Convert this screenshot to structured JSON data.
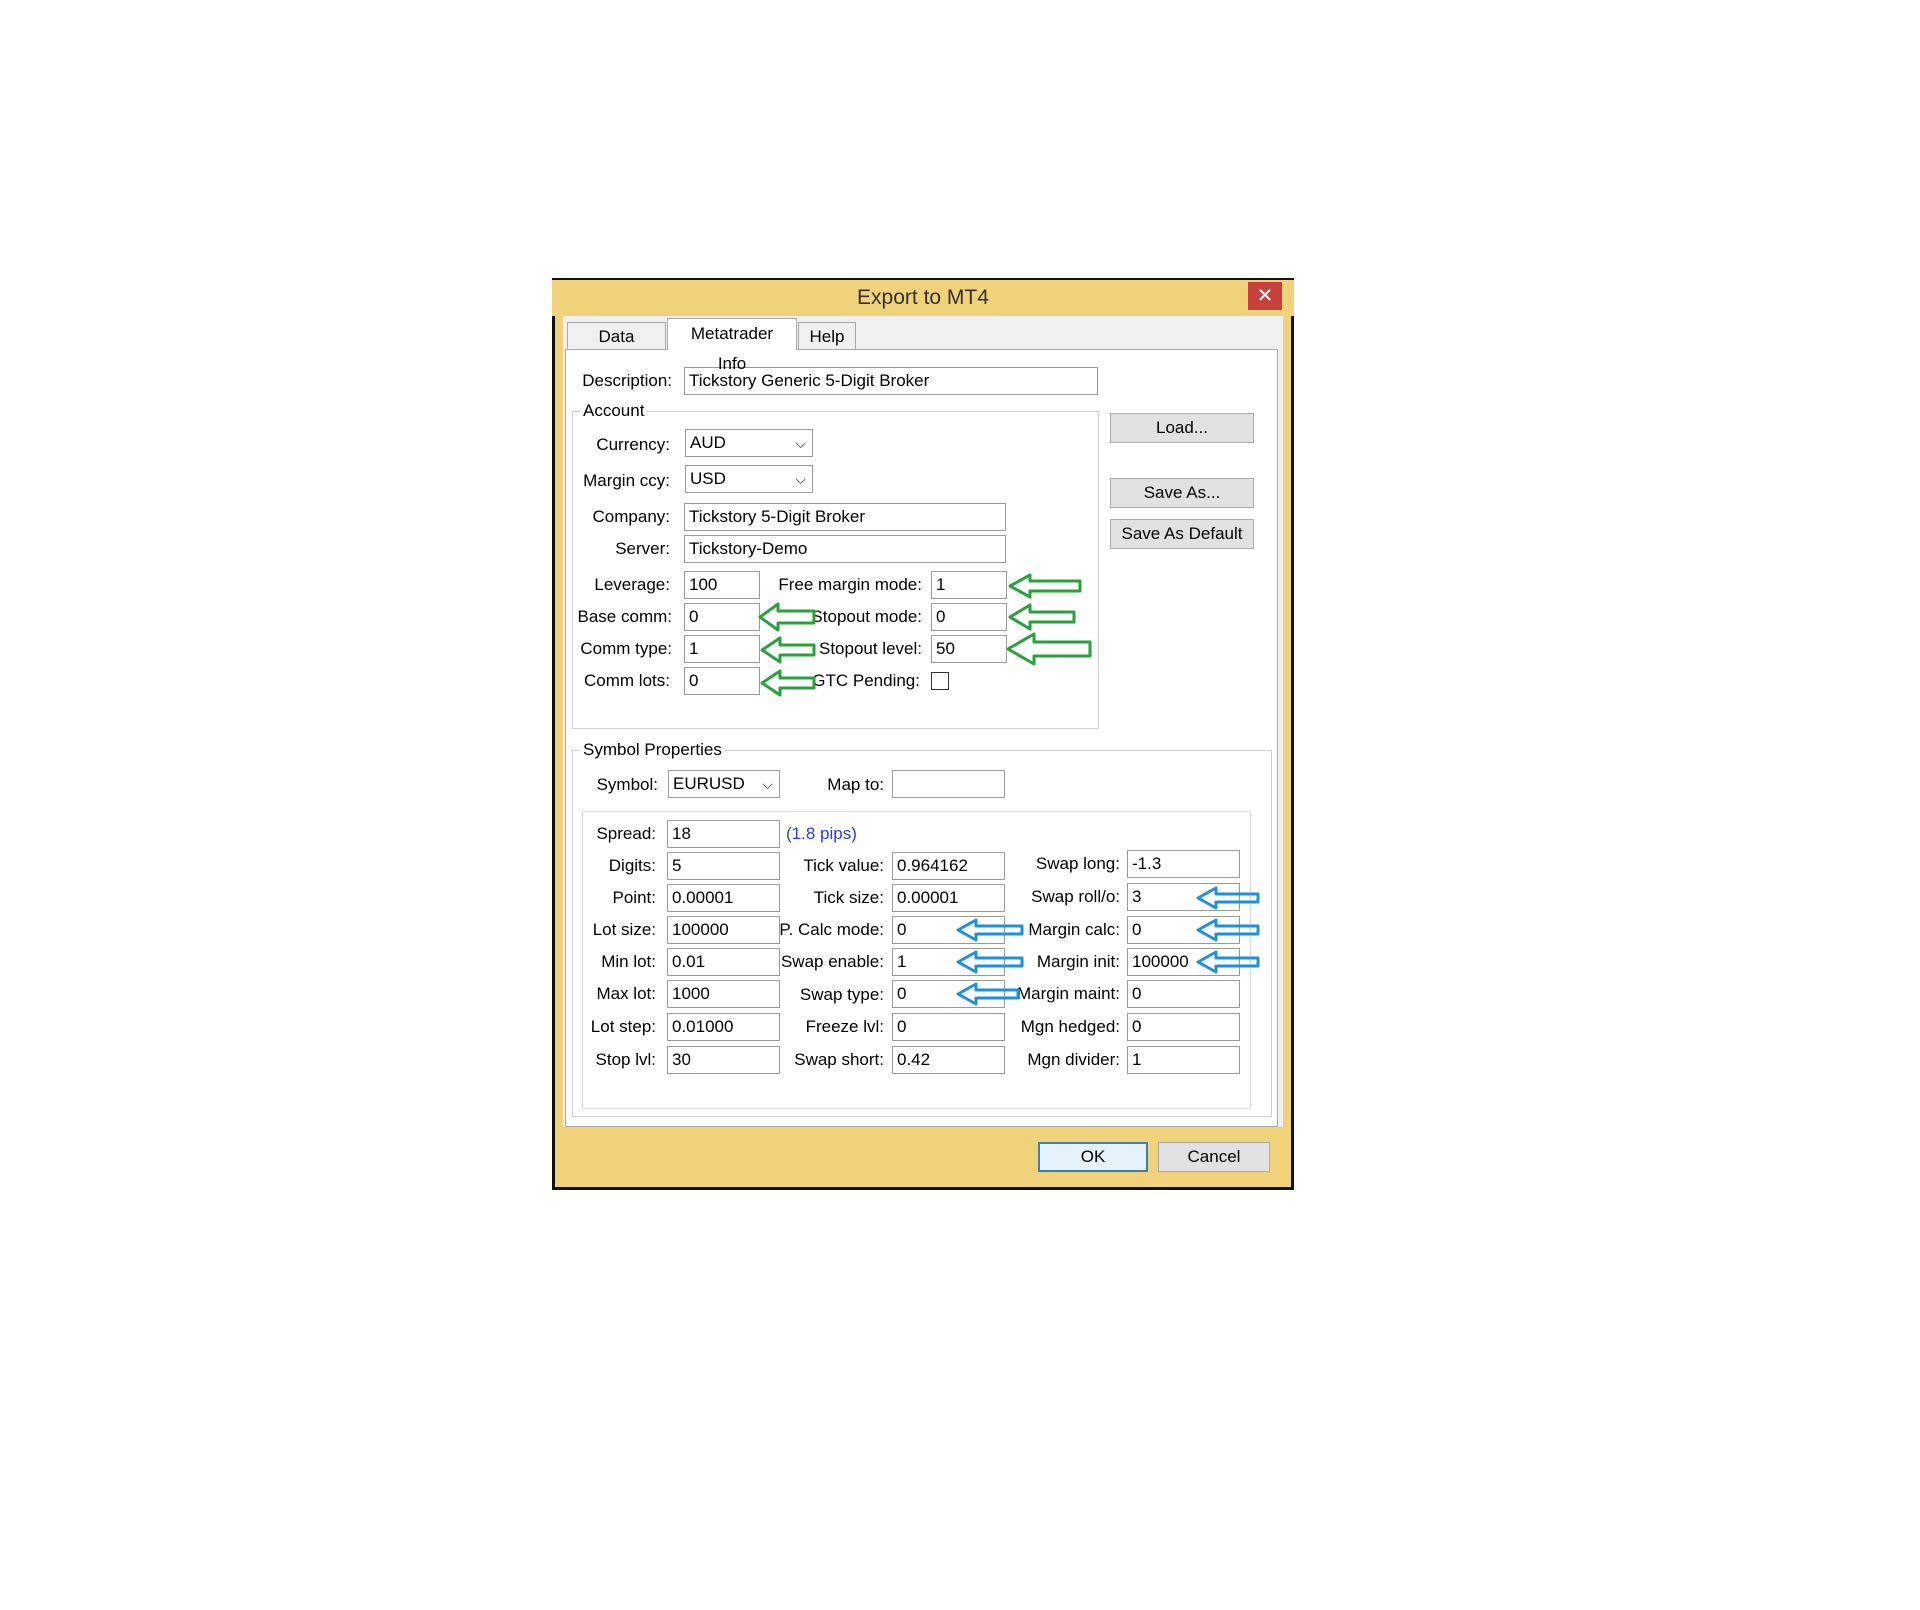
{
  "window": {
    "title": "Export to MT4",
    "close_glyph": "✕"
  },
  "tabs": [
    {
      "label": "Data export",
      "active": false
    },
    {
      "label": "Metatrader Info",
      "active": true
    },
    {
      "label": "Help",
      "active": false
    }
  ],
  "description": {
    "label": "Description:",
    "value": "Tickstory Generic 5-Digit Broker"
  },
  "account": {
    "legend": "Account",
    "currency": {
      "label": "Currency:",
      "value": "AUD"
    },
    "margin_ccy": {
      "label": "Margin ccy:",
      "value": "USD"
    },
    "company": {
      "label": "Company:",
      "value": "Tickstory 5-Digit Broker"
    },
    "server": {
      "label": "Server:",
      "value": "Tickstory-Demo"
    },
    "leverage": {
      "label": "Leverage:",
      "value": "100"
    },
    "base_comm": {
      "label": "Base comm:",
      "value": "0"
    },
    "comm_type": {
      "label": "Comm type:",
      "value": "1"
    },
    "comm_lots": {
      "label": "Comm lots:",
      "value": "0"
    },
    "free_margin_mode": {
      "label": "Free margin mode:",
      "value": "1"
    },
    "stopout_mode": {
      "label": "Stopout mode:",
      "value": "0"
    },
    "stopout_level": {
      "label": "Stopout level:",
      "value": "50"
    },
    "gtc_pending": {
      "label": "GTC Pending:",
      "checked": false
    }
  },
  "side_buttons": {
    "load": "Load...",
    "save_as": "Save As...",
    "save_as_default": "Save As Default"
  },
  "symbol_props": {
    "legend": "Symbol Properties",
    "symbol": {
      "label": "Symbol:",
      "value": "EURUSD"
    },
    "map_to": {
      "label": "Map to:",
      "value": ""
    },
    "spread": {
      "label": "Spread:",
      "value": "18",
      "note": "(1.8 pips)"
    },
    "digits": {
      "label": "Digits:",
      "value": "5"
    },
    "point": {
      "label": "Point:",
      "value": "0.00001"
    },
    "lot_size": {
      "label": "Lot size:",
      "value": "100000"
    },
    "min_lot": {
      "label": "Min lot:",
      "value": "0.01"
    },
    "max_lot": {
      "label": "Max lot:",
      "value": "1000"
    },
    "lot_step": {
      "label": "Lot step:",
      "value": "0.01000"
    },
    "stop_lvl": {
      "label": "Stop lvl:",
      "value": "30"
    },
    "tick_value": {
      "label": "Tick value:",
      "value": "0.964162"
    },
    "tick_size": {
      "label": "Tick size:",
      "value": "0.00001"
    },
    "p_calc_mode": {
      "label": "P. Calc mode:",
      "value": "0"
    },
    "swap_enable": {
      "label": "Swap enable:",
      "value": "1"
    },
    "swap_type": {
      "label": "Swap type:",
      "value": "0"
    },
    "freeze_lvl": {
      "label": "Freeze lvl:",
      "value": "0"
    },
    "swap_short": {
      "label": "Swap short:",
      "value": "0.42"
    },
    "swap_long": {
      "label": "Swap long:",
      "value": "-1.3"
    },
    "swap_rollo": {
      "label": "Swap roll/o:",
      "value": "3"
    },
    "margin_calc": {
      "label": "Margin calc:",
      "value": "0"
    },
    "margin_init": {
      "label": "Margin init:",
      "value": "100000"
    },
    "margin_maint": {
      "label": "Margin maint:",
      "value": "0"
    },
    "mgn_hedged": {
      "label": "Mgn hedged:",
      "value": "0"
    },
    "mgn_divider": {
      "label": "Mgn divider:",
      "value": "1"
    }
  },
  "footer": {
    "ok": "OK",
    "cancel": "Cancel"
  },
  "annotation_colors": {
    "green": "#2aa03c",
    "blue": "#1e90d6"
  },
  "icons": {
    "dropdown": "chevron-down-icon",
    "close": "close-icon",
    "arrow": "left-arrow-icon"
  }
}
